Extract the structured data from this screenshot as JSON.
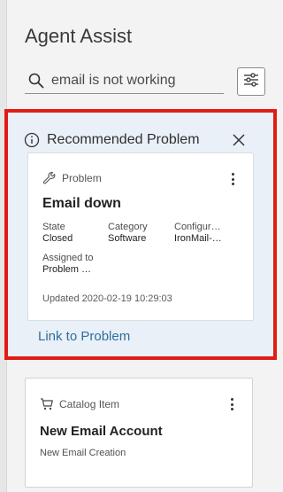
{
  "header": {
    "title": "Agent Assist"
  },
  "search": {
    "value": "email is not working"
  },
  "recommended": {
    "title": "Recommended Problem",
    "card": {
      "type_label": "Problem",
      "title": "Email down",
      "fields": [
        {
          "label": "State",
          "value": "Closed"
        },
        {
          "label": "Category",
          "value": "Software"
        },
        {
          "label": "Configur…",
          "value": "IronMail-…"
        },
        {
          "label": "Assigned to",
          "value": "Problem …"
        }
      ],
      "updated": "Updated 2020-02-19 10:29:03"
    },
    "link_label": "Link to Problem"
  },
  "catalog_item": {
    "type_label": "Catalog Item",
    "title": "New Email Account",
    "subtitle": "New Email Creation"
  },
  "colors": {
    "highlight_border": "#e31b14",
    "recommended_bg": "#e9f0f7",
    "link": "#2e6f9e"
  },
  "icons": [
    "search-icon",
    "filter-icon",
    "info-icon",
    "close-icon",
    "wrench-icon",
    "kebab-icon",
    "cart-icon"
  ]
}
